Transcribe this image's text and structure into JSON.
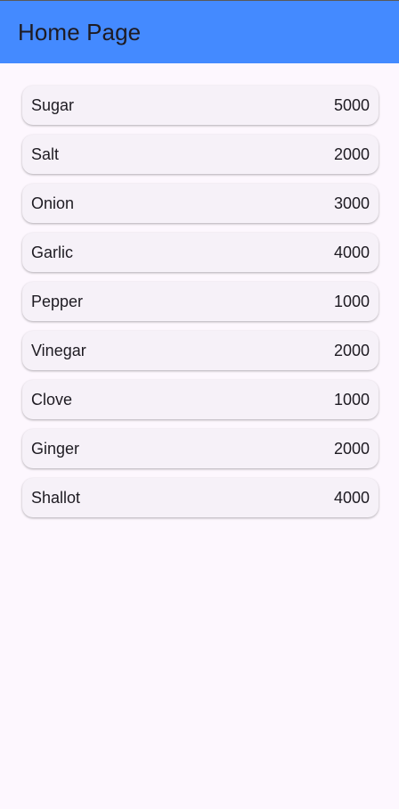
{
  "app_bar": {
    "title": "Home Page",
    "color": "#448AFF"
  },
  "items": [
    {
      "name": "Sugar",
      "qty": "5000"
    },
    {
      "name": "Salt",
      "qty": "2000"
    },
    {
      "name": "Onion",
      "qty": "3000"
    },
    {
      "name": "Garlic",
      "qty": "4000"
    },
    {
      "name": "Pepper",
      "qty": "1000"
    },
    {
      "name": "Vinegar",
      "qty": "2000"
    },
    {
      "name": "Clove",
      "qty": "1000"
    },
    {
      "name": "Ginger",
      "qty": "2000"
    },
    {
      "name": "Shallot",
      "qty": "4000"
    }
  ]
}
